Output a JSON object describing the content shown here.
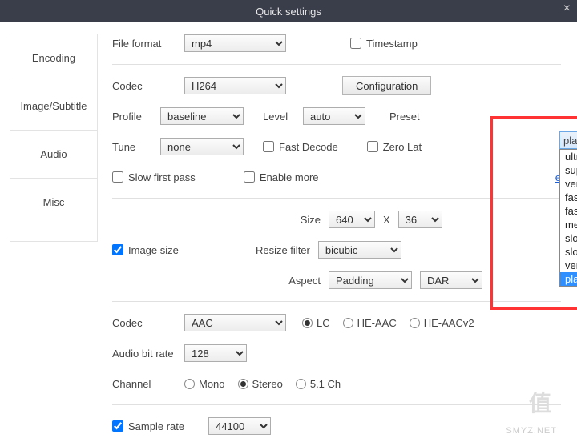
{
  "title": "Quick settings",
  "sidebar": {
    "tabs": [
      "Encoding",
      "Image/Subtitle",
      "Audio",
      "Misc"
    ]
  },
  "encoding": {
    "file_format_label": "File format",
    "file_format": "mp4",
    "timestamp_label": "Timestamp",
    "codec_label": "Codec",
    "codec": "H264",
    "configuration_btn": "Configuration",
    "profile_label": "Profile",
    "profile": "baseline",
    "level_label": "Level",
    "level": "auto",
    "preset_label": "Preset",
    "preset_selected": "placebo",
    "preset_options": [
      "ultrafast",
      "superfast",
      "veryfast",
      "faster",
      "fast",
      "medium",
      "slow",
      "slower",
      "veryslow",
      "placebo"
    ],
    "tune_label": "Tune",
    "tune": "none",
    "fast_decode_label": "Fast Decode",
    "zero_lat_label": "Zero Lat",
    "slow_first_pass_label": "Slow first pass",
    "enable_more_label": "Enable more",
    "more_link": "e"
  },
  "image": {
    "image_size_label": "Image size",
    "size_label": "Size",
    "size_w": "640",
    "size_x": "X",
    "size_h": "36",
    "resize_filter_label": "Resize filter",
    "resize_filter": "bicubic",
    "aspect_label": "Aspect",
    "aspect": "Padding",
    "dar": "DAR"
  },
  "audio": {
    "codec_label": "Codec",
    "codec": "AAC",
    "lc": "LC",
    "heaac": "HE-AAC",
    "heaacv2": "HE-AACv2",
    "bitrate_label": "Audio bit rate",
    "bitrate": "128",
    "channel_label": "Channel",
    "mono": "Mono",
    "stereo": "Stereo",
    "ch51": "5.1 Ch",
    "sample_rate_label": "Sample rate",
    "sample_rate": "44100"
  },
  "watermark": {
    "logo": "值",
    "text": "SMYZ.NET"
  }
}
